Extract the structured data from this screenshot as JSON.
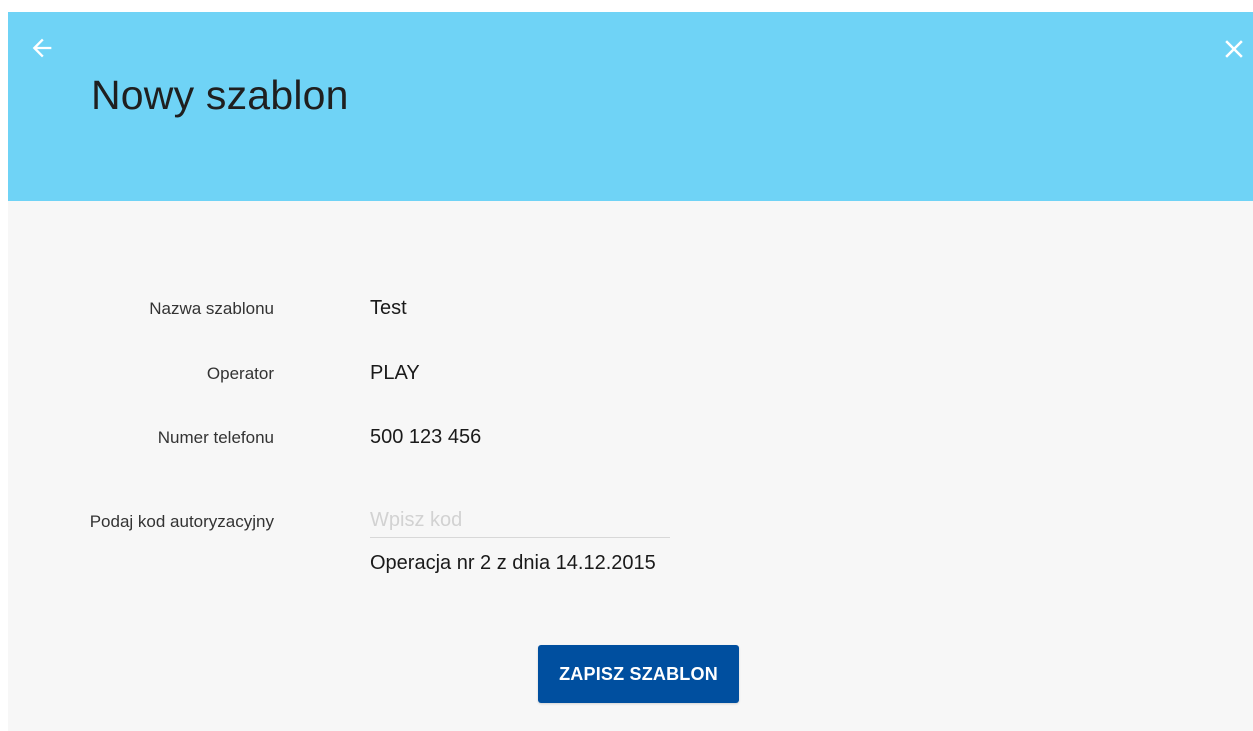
{
  "header": {
    "title": "Nowy szablon",
    "back_icon": "arrow-left-icon",
    "close_icon": "close-icon",
    "background_color": "#6fd3f6"
  },
  "form": {
    "fields": [
      {
        "label": "Nazwa szablonu",
        "value": "Test"
      },
      {
        "label": "Operator",
        "value": "PLAY"
      },
      {
        "label": "Numer telefonu",
        "value": "500 123 456"
      }
    ],
    "auth_code": {
      "label": "Podaj kod autoryzacyjny",
      "value": "",
      "placeholder": "Wpisz kod",
      "operation_info": "Operacja nr 2 z dnia 14.12.2015"
    },
    "save_label": "ZAPISZ SZABLON",
    "button_color": "#004f9f"
  }
}
